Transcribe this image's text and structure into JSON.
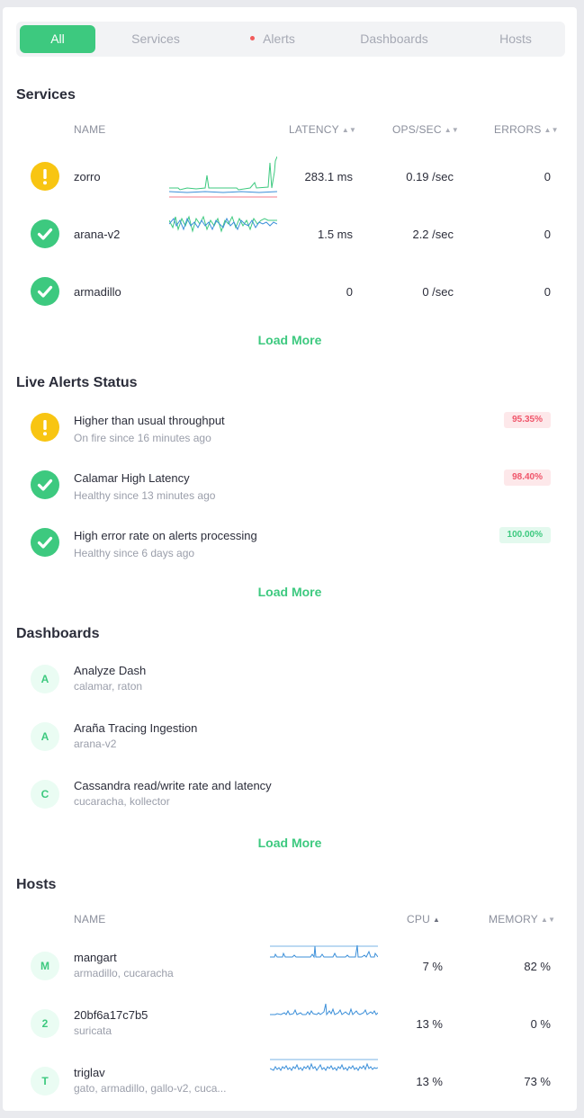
{
  "tabs": [
    {
      "label": "All",
      "active": true
    },
    {
      "label": "Services",
      "active": false
    },
    {
      "label": "Alerts",
      "active": false,
      "has_dot": true
    },
    {
      "label": "Dashboards",
      "active": false
    },
    {
      "label": "Hosts",
      "active": false
    }
  ],
  "services": {
    "title": "Services",
    "columns": {
      "name": "NAME",
      "latency": "LATENCY",
      "ops": "OPS/SEC",
      "errors": "ERRORS"
    },
    "rows": [
      {
        "status": "warning",
        "name": "zorro",
        "latency": "283.1 ms",
        "ops": "0.19 /sec",
        "errors": "0"
      },
      {
        "status": "ok",
        "name": "arana-v2",
        "latency": "1.5 ms",
        "ops": "2.2 /sec",
        "errors": "0"
      },
      {
        "status": "ok",
        "name": "armadillo",
        "latency": "0",
        "ops": "0 /sec",
        "errors": "0"
      }
    ],
    "load_more": "Load More"
  },
  "alerts": {
    "title": "Live Alerts Status",
    "rows": [
      {
        "status": "warning",
        "name": "Higher than usual throughput",
        "sub": "On fire since 16 minutes ago",
        "badge": "95.35%",
        "badge_color": "red"
      },
      {
        "status": "ok",
        "name": "Calamar High Latency",
        "sub": "Healthy since 13 minutes ago",
        "badge": "98.40%",
        "badge_color": "red"
      },
      {
        "status": "ok",
        "name": "High error rate on alerts processing",
        "sub": "Healthy since 6 days ago",
        "badge": "100.00%",
        "badge_color": "green"
      }
    ],
    "load_more": "Load More"
  },
  "dashboards": {
    "title": "Dashboards",
    "rows": [
      {
        "initial": "A",
        "name": "Analyze Dash",
        "sub": "calamar, raton"
      },
      {
        "initial": "A",
        "name": "Araña Tracing Ingestion",
        "sub": "arana-v2"
      },
      {
        "initial": "C",
        "name": "Cassandra read/write rate and latency",
        "sub": "cucaracha, kollector"
      }
    ],
    "load_more": "Load More"
  },
  "hosts": {
    "title": "Hosts",
    "columns": {
      "name": "NAME",
      "cpu": "CPU",
      "memory": "MEMORY"
    },
    "rows": [
      {
        "initial": "M",
        "name": "mangart",
        "sub": "armadillo, cucaracha",
        "cpu": "7 %",
        "memory": "82 %"
      },
      {
        "initial": "2",
        "name": "20bf6a17c7b5",
        "sub": "suricata",
        "cpu": "13 %",
        "memory": "0 %"
      },
      {
        "initial": "T",
        "name": "triglav",
        "sub": "gato, armadillo, gallo-v2, cuca...",
        "cpu": "13 %",
        "memory": "73 %"
      }
    ]
  },
  "colors": {
    "accent": "#3dc97f",
    "warning": "#f8c512",
    "danger": "#f0556a",
    "spark_green": "#3dc97f",
    "spark_blue": "#3b8fd9"
  }
}
